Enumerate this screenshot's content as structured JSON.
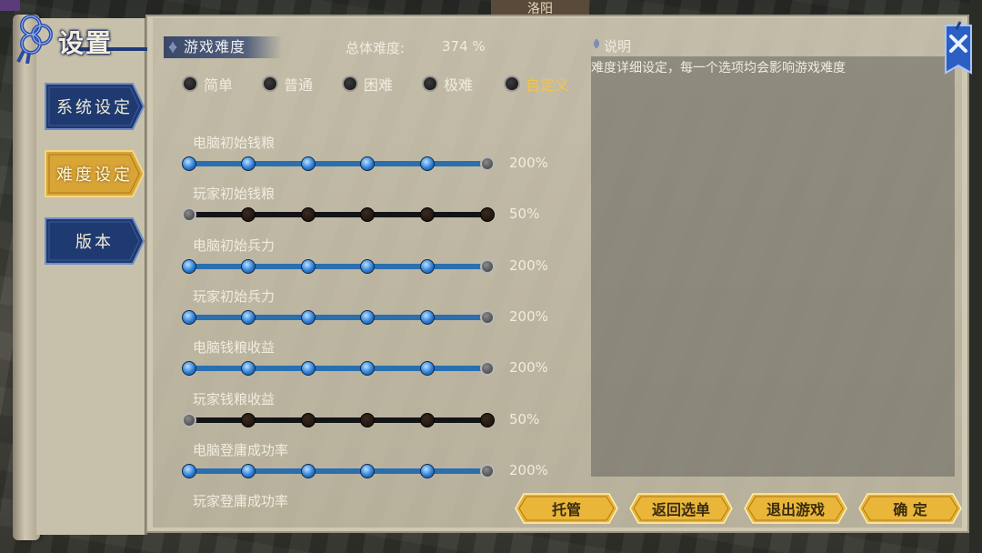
{
  "top_bar": {
    "city_label": "洛阳"
  },
  "title": "设置",
  "nav": {
    "items": [
      {
        "label": "系统设定",
        "active": false
      },
      {
        "label": "难度设定",
        "active": true
      },
      {
        "label": "版本",
        "active": false
      }
    ]
  },
  "header": {
    "section_tab": "游戏难度",
    "overall_label": "总体难度:",
    "overall_value": "374 %"
  },
  "description": {
    "title": "说明",
    "text": "难度详细设定，每一个选项均会影响游戏难度"
  },
  "difficulty_options": [
    {
      "label": "简单",
      "selected": false
    },
    {
      "label": "普通",
      "selected": false
    },
    {
      "label": "困难",
      "selected": false
    },
    {
      "label": "极难",
      "selected": false
    },
    {
      "label": "自定义",
      "selected": true
    }
  ],
  "sliders": [
    {
      "label": "电脑初始钱粮",
      "value": "200%",
      "level": 5,
      "max": 5
    },
    {
      "label": "玩家初始钱粮",
      "value": "50%",
      "level": 0,
      "max": 5
    },
    {
      "label": "电脑初始兵力",
      "value": "200%",
      "level": 5,
      "max": 5
    },
    {
      "label": "玩家初始兵力",
      "value": "200%",
      "level": 5,
      "max": 5
    },
    {
      "label": "电脑钱粮收益",
      "value": "200%",
      "level": 5,
      "max": 5
    },
    {
      "label": "玩家钱粮收益",
      "value": "50%",
      "level": 0,
      "max": 5
    },
    {
      "label": "电脑登庸成功率",
      "value": "200%",
      "level": 5,
      "max": 5
    },
    {
      "label": "玩家登庸成功率",
      "value": "",
      "level": null,
      "max": 5
    }
  ],
  "buttons": {
    "auto": "托管",
    "back": "返回选单",
    "exit": "退出游戏",
    "confirm": "确 定"
  },
  "colors": {
    "accent_gold": "#f5c542",
    "slider_blue": "#2f7ed6",
    "nav_blue": "#1f3a70",
    "button_gold": "#e9b63a"
  }
}
